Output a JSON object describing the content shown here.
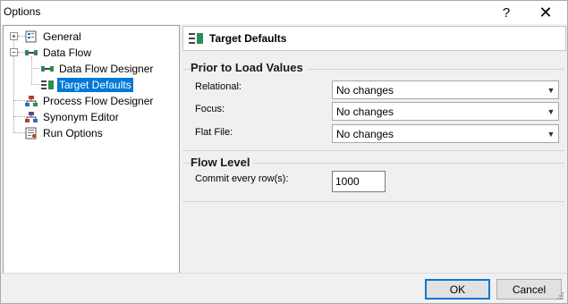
{
  "window": {
    "title": "Options",
    "help_glyph": "?",
    "close_glyph": "✕"
  },
  "tree": {
    "items": [
      {
        "label": "General",
        "icon": "general-settings-icon"
      },
      {
        "label": "Data Flow",
        "icon": "data-flow-icon"
      },
      {
        "label": "Data Flow Designer",
        "icon": "data-flow-designer-icon"
      },
      {
        "label": "Target Defaults",
        "icon": "target-defaults-icon",
        "selected": true
      },
      {
        "label": "Process Flow Designer",
        "icon": "process-flow-icon"
      },
      {
        "label": "Synonym Editor",
        "icon": "synonym-editor-icon"
      },
      {
        "label": "Run Options",
        "icon": "run-options-icon"
      }
    ],
    "expander_plus": "+",
    "expander_minus": "−"
  },
  "panel": {
    "title": "Target Defaults",
    "prior_group": {
      "title": "Prior to Load Values",
      "fields": [
        {
          "label": "Relational:",
          "value": "No changes"
        },
        {
          "label": "Focus:",
          "value": "No changes"
        },
        {
          "label": "Flat File:",
          "value": "No changes"
        }
      ]
    },
    "flow_group": {
      "title": "Flow Level",
      "commit_label": "Commit every row(s):",
      "commit_value": "1000"
    }
  },
  "buttons": {
    "ok": "OK",
    "cancel": "Cancel"
  },
  "colors": {
    "selection": "#0078d7",
    "accent_green": "#2e8b57"
  }
}
